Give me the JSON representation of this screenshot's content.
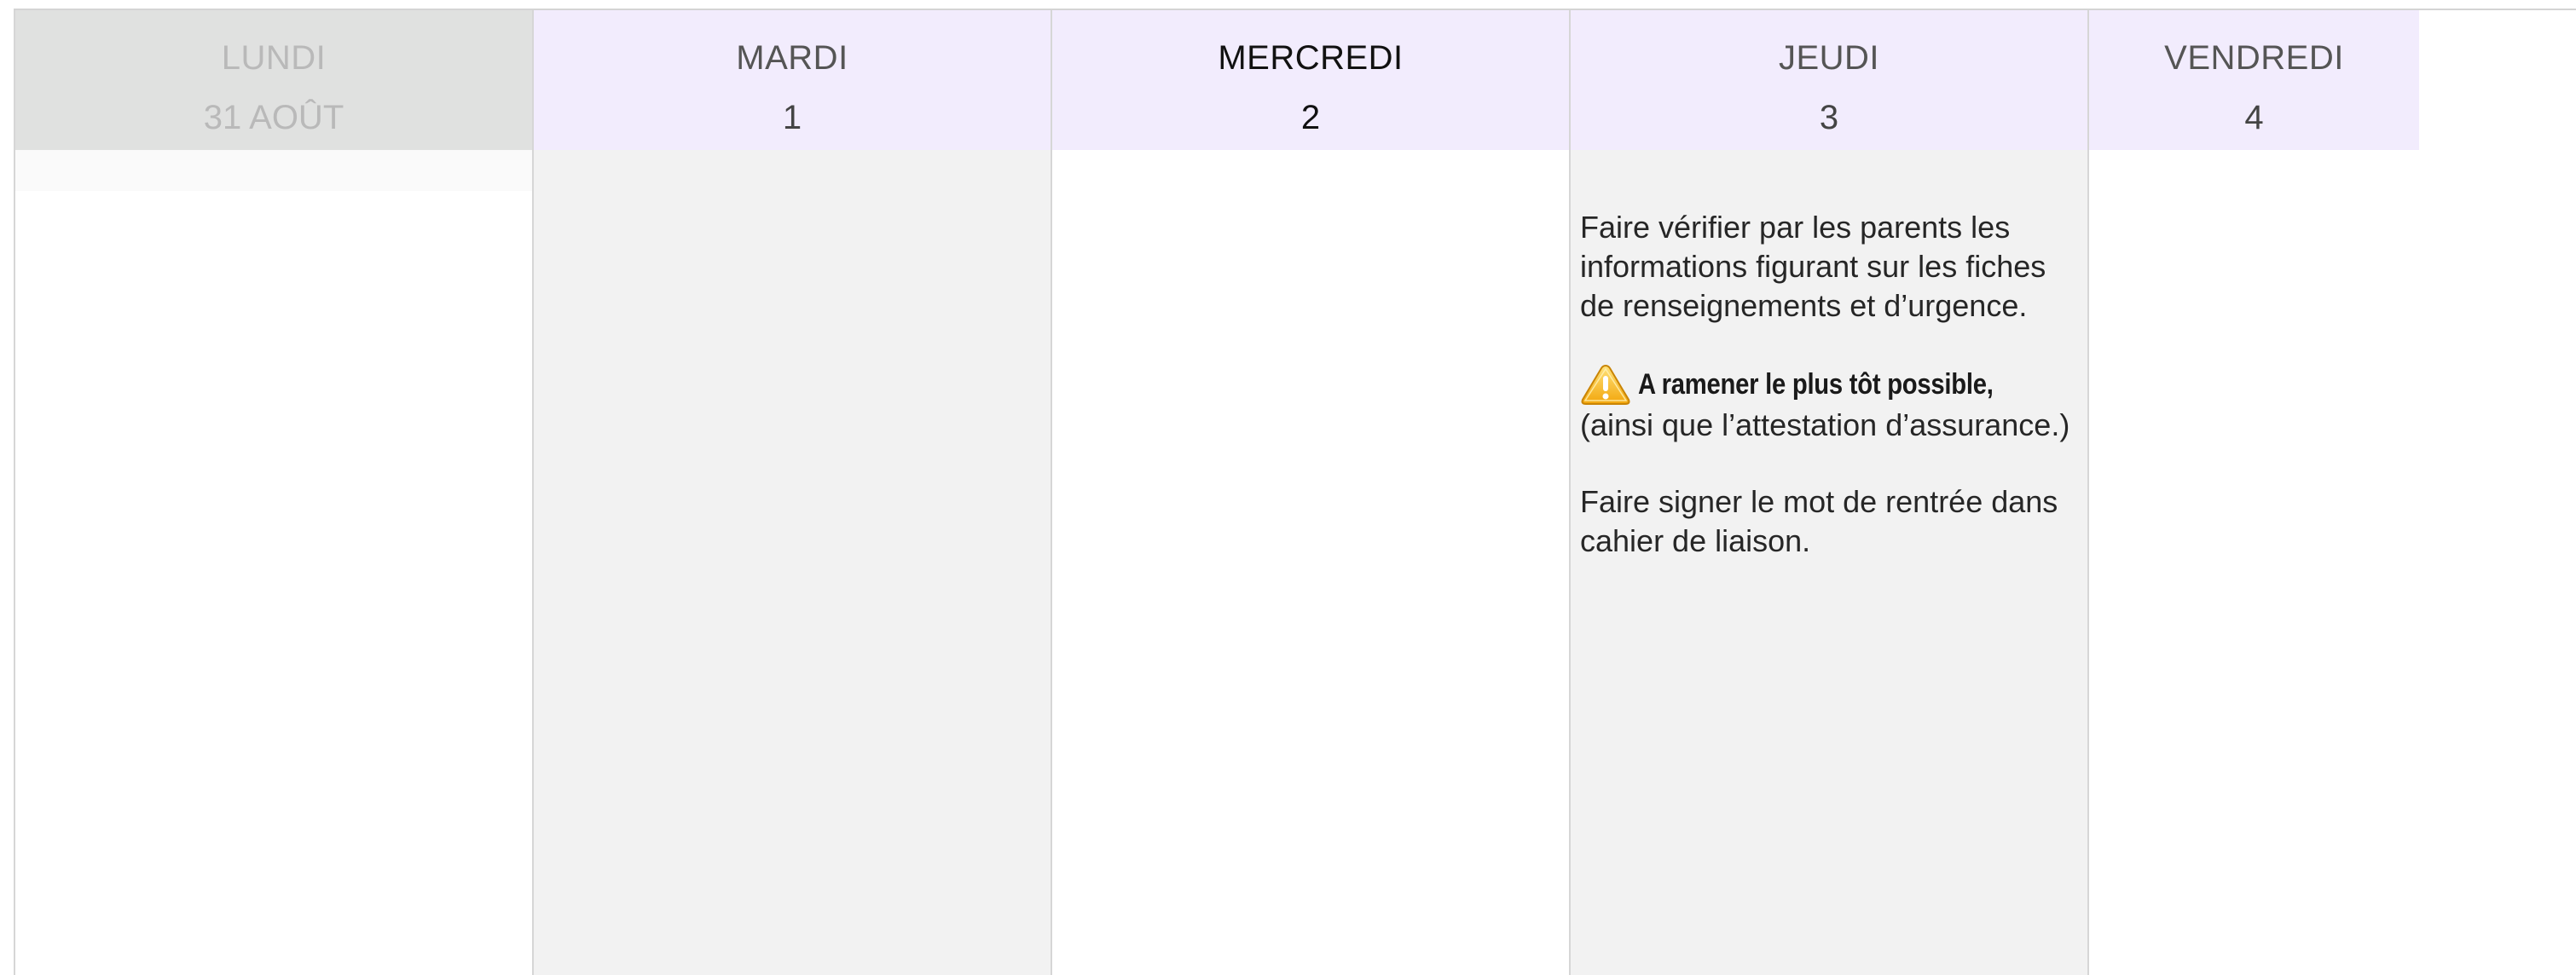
{
  "calendar": {
    "days": [
      {
        "name": "LUNDI",
        "date": "31 AOÛT"
      },
      {
        "name": "MARDI",
        "date": "1"
      },
      {
        "name": "MERCREDI",
        "date": "2"
      },
      {
        "name": "JEUDI",
        "date": "3"
      },
      {
        "name": "VENDREDI",
        "date": "4"
      }
    ],
    "note": {
      "para1": "Faire vérifier par les parents les informations figurant sur les fiches de renseignements et d’urgence.",
      "warning_bold": "A ramener le plus tôt possible,",
      "warning_rest": "(ainsi que l’attestation d’assurance.)",
      "para3": "Faire signer le mot de rentrée dans cahier de liaison."
    }
  },
  "icons": {
    "warning": "warning-triangle-icon"
  },
  "colors": {
    "header_bg": "#f2ecfd",
    "past_header_bg": "#e0e1e0",
    "shaded_column": "#f2f2f2",
    "warning_yellow": "#f5b50a"
  }
}
